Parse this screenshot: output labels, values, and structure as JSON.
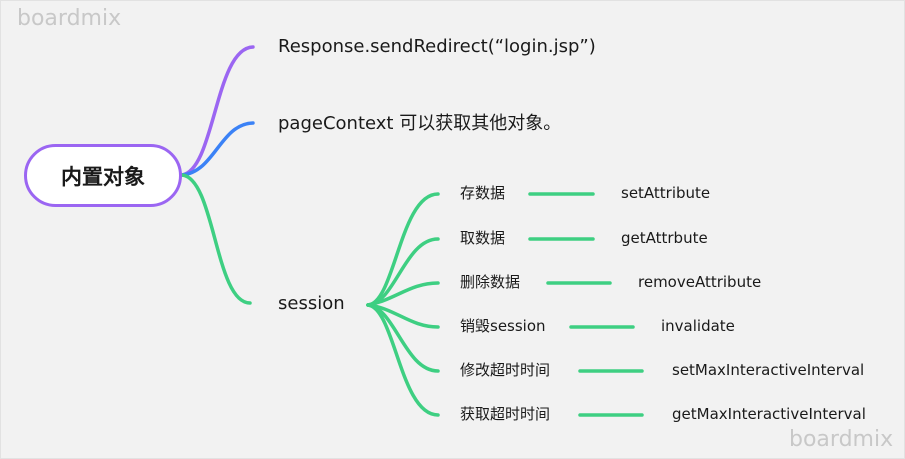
{
  "watermark": "boardmix",
  "colors": {
    "purple": "#9b66f2",
    "blue": "#3b82f6",
    "green": "#3ecf82"
  },
  "root": {
    "label": "内置对象"
  },
  "branches": [
    {
      "label": "Response.sendRedirect(“login.jsp”)",
      "color": "purple"
    },
    {
      "label": "pageContext 可以获取其他对象。",
      "color": "blue"
    },
    {
      "label": "session",
      "color": "green",
      "children": [
        {
          "label": "存数据",
          "method": "setAttribute"
        },
        {
          "label": "取数据",
          "method": "getAttrbute"
        },
        {
          "label": "删除数据",
          "method": "removeAttribute"
        },
        {
          "label": "销毁session",
          "method": "invalidate"
        },
        {
          "label": "修改超时时间",
          "method": "setMaxInteractiveInterval"
        },
        {
          "label": "获取超时时间",
          "method": "getMaxInteractiveInterval"
        }
      ]
    }
  ]
}
